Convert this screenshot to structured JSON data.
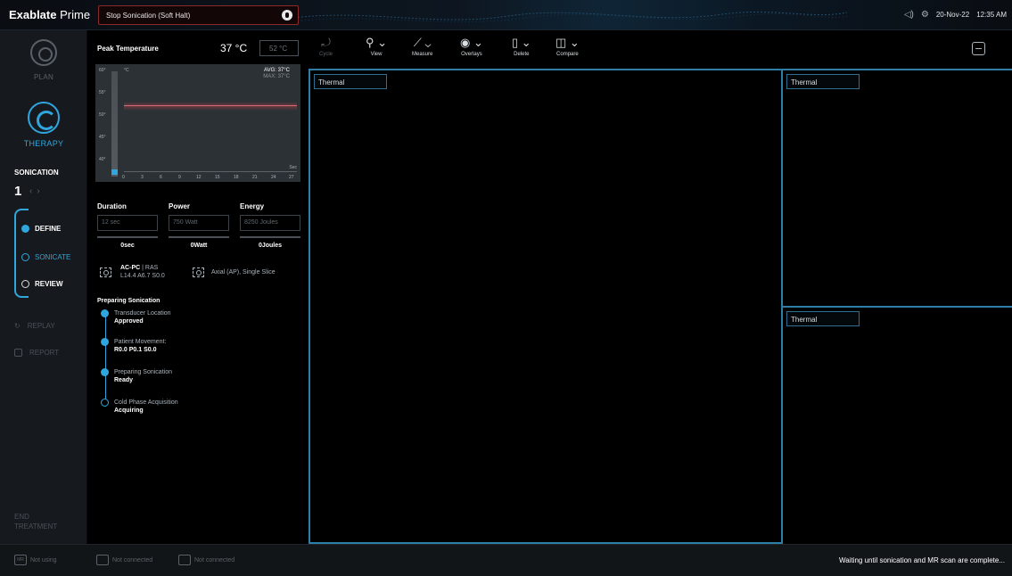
{
  "app": {
    "brand_bold": "Exablate",
    "brand_rest": " Prime"
  },
  "header": {
    "stop_label": "Stop Sonication (Soft Halt)",
    "date": "20-Nov-22",
    "time": "12:35 AM"
  },
  "nav": {
    "plan": "PLAN",
    "therapy": "THERAPY",
    "sonication_heading": "SONICATION",
    "sonication_number": "1",
    "steps": [
      {
        "label": "DEFINE",
        "state": "done"
      },
      {
        "label": "SONICATE",
        "state": "current"
      },
      {
        "label": "REVIEW",
        "state": "pending"
      }
    ],
    "replay": "REPLAY",
    "report": "REPORT",
    "end_treatment_1": "END",
    "end_treatment_2": "TREATMENT"
  },
  "panel": {
    "peak_heading": "Peak Temperature",
    "peak_value": "37 °C",
    "peak_max": "52 °C",
    "chart": {
      "unit_temp": "°C",
      "unit_time": "Sec",
      "avg_label": "AVG:",
      "avg_value": "37°C",
      "max_label": "MAX:",
      "max_value": "37°C",
      "y_ticks": [
        "60°",
        "55°",
        "50°",
        "45°",
        "40°"
      ],
      "x_ticks": [
        "0",
        "3",
        "6",
        "9",
        "12",
        "15",
        "18",
        "21",
        "24",
        "27"
      ]
    },
    "duration_label": "Duration",
    "duration_value": "12  sec",
    "duration_actual": "0sec",
    "power_label": "Power",
    "power_value": "750 Watt",
    "power_actual": "0Watt",
    "energy_label": "Energy",
    "energy_value": "8250 Joules",
    "energy_actual": "0Joules",
    "coord_system": "AC-PC",
    "coord_frame": "RAS",
    "coord_values": "L14.4 A6.7 S0.0",
    "slice_label": "Axial (AP), Single Slice",
    "prep_heading": "Preparing Sonication",
    "prep_items": [
      {
        "label": "Transducer Location",
        "value": "Approved",
        "done": true
      },
      {
        "label": "Patient Movement:",
        "value": "R0.0 P0.1 S0.0",
        "done": true
      },
      {
        "label": "Preparing Sonication",
        "value": "Ready",
        "done": true
      },
      {
        "label": "Cold Phase Acquisition",
        "value": "Acquiring",
        "done": false
      }
    ]
  },
  "toolbar": {
    "cycle": "Cycle",
    "view": "View",
    "measure": "Measure",
    "overlays": "Overlays",
    "delete": "Delete",
    "compare": "Compare"
  },
  "viewports": {
    "main": "Thermal",
    "right_top": "Thermal",
    "right_bottom": "Thermal"
  },
  "status": {
    "mr_tag": "MR",
    "mr_text": "Not using",
    "dev1_text": "Not connected",
    "dev2_text": "Not connected",
    "message": "Waiting until sonication and MR scan are complete..."
  }
}
